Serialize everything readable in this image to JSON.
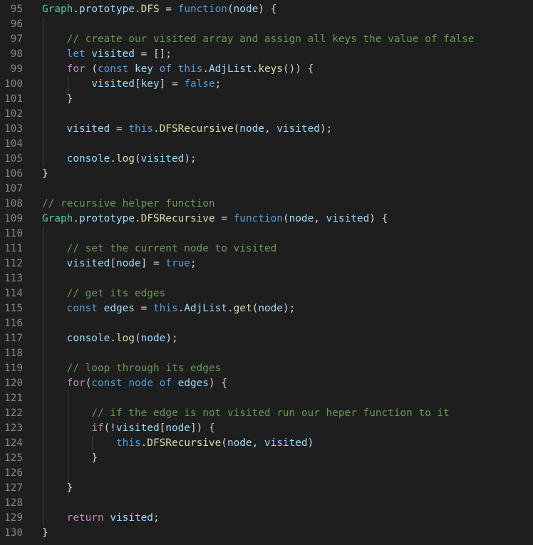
{
  "theme": {
    "background": "#1e1e1e",
    "line_number": "#858585",
    "guide": "#404040",
    "colors": {
      "plain": "#d4d4d4",
      "class": "#4ec9b0",
      "prop": "#9cdcfe",
      "func": "#dcdcaa",
      "kw": "#569cd6",
      "ctrl": "#c586c0",
      "var": "#9cdcfe",
      "param": "#9cdcfe",
      "cmt": "#6a9955",
      "op": "#d4d4d4",
      "punc": "#d4d4d4"
    }
  },
  "editor": {
    "lines": [
      {
        "num": "95",
        "tokens": [
          [
            "class",
            "Graph"
          ],
          [
            "punc",
            "."
          ],
          [
            "prop",
            "prototype"
          ],
          [
            "punc",
            "."
          ],
          [
            "func",
            "DFS"
          ],
          [
            "op",
            " = "
          ],
          [
            "kw",
            "function"
          ],
          [
            "punc",
            "("
          ],
          [
            "param",
            "node"
          ],
          [
            "punc",
            ") {"
          ]
        ]
      },
      {
        "num": "96",
        "tokens": []
      },
      {
        "num": "97",
        "tokens": [
          [
            "plain",
            "    "
          ],
          [
            "cmt",
            "// create our visited array and assign all keys the value of false"
          ]
        ]
      },
      {
        "num": "98",
        "tokens": [
          [
            "plain",
            "    "
          ],
          [
            "kw",
            "let"
          ],
          [
            "plain",
            " "
          ],
          [
            "var",
            "visited"
          ],
          [
            "op",
            " = "
          ],
          [
            "punc",
            "[];"
          ]
        ]
      },
      {
        "num": "99",
        "tokens": [
          [
            "plain",
            "    "
          ],
          [
            "ctrl",
            "for"
          ],
          [
            "punc",
            " ("
          ],
          [
            "kw",
            "const"
          ],
          [
            "plain",
            " "
          ],
          [
            "var",
            "key"
          ],
          [
            "plain",
            " "
          ],
          [
            "kw",
            "of"
          ],
          [
            "plain",
            " "
          ],
          [
            "kw",
            "this"
          ],
          [
            "punc",
            "."
          ],
          [
            "prop",
            "AdjList"
          ],
          [
            "punc",
            "."
          ],
          [
            "func",
            "keys"
          ],
          [
            "punc",
            "()) {"
          ]
        ]
      },
      {
        "num": "100",
        "tokens": [
          [
            "plain",
            "        "
          ],
          [
            "var",
            "visited"
          ],
          [
            "punc",
            "["
          ],
          [
            "var",
            "key"
          ],
          [
            "punc",
            "]"
          ],
          [
            "op",
            " = "
          ],
          [
            "kw",
            "false"
          ],
          [
            "punc",
            ";"
          ]
        ]
      },
      {
        "num": "101",
        "tokens": [
          [
            "plain",
            "    "
          ],
          [
            "punc",
            "}"
          ]
        ]
      },
      {
        "num": "102",
        "tokens": []
      },
      {
        "num": "103",
        "tokens": [
          [
            "plain",
            "    "
          ],
          [
            "var",
            "visited"
          ],
          [
            "op",
            " = "
          ],
          [
            "kw",
            "this"
          ],
          [
            "punc",
            "."
          ],
          [
            "func",
            "DFSRecursive"
          ],
          [
            "punc",
            "("
          ],
          [
            "var",
            "node"
          ],
          [
            "punc",
            ", "
          ],
          [
            "var",
            "visited"
          ],
          [
            "punc",
            ");"
          ]
        ]
      },
      {
        "num": "104",
        "tokens": []
      },
      {
        "num": "105",
        "tokens": [
          [
            "plain",
            "    "
          ],
          [
            "var",
            "console"
          ],
          [
            "punc",
            "."
          ],
          [
            "func",
            "log"
          ],
          [
            "punc",
            "("
          ],
          [
            "var",
            "visited"
          ],
          [
            "punc",
            ");"
          ]
        ]
      },
      {
        "num": "106",
        "tokens": [
          [
            "punc",
            "}"
          ]
        ]
      },
      {
        "num": "107",
        "tokens": []
      },
      {
        "num": "108",
        "tokens": [
          [
            "cmt",
            "// recursive helper function"
          ]
        ]
      },
      {
        "num": "109",
        "tokens": [
          [
            "class",
            "Graph"
          ],
          [
            "punc",
            "."
          ],
          [
            "prop",
            "prototype"
          ],
          [
            "punc",
            "."
          ],
          [
            "func",
            "DFSRecursive"
          ],
          [
            "op",
            " = "
          ],
          [
            "kw",
            "function"
          ],
          [
            "punc",
            "("
          ],
          [
            "param",
            "node"
          ],
          [
            "punc",
            ", "
          ],
          [
            "param",
            "visited"
          ],
          [
            "punc",
            ") {"
          ]
        ]
      },
      {
        "num": "110",
        "tokens": []
      },
      {
        "num": "111",
        "tokens": [
          [
            "plain",
            "    "
          ],
          [
            "cmt",
            "// set the current node to visited"
          ]
        ]
      },
      {
        "num": "112",
        "tokens": [
          [
            "plain",
            "    "
          ],
          [
            "var",
            "visited"
          ],
          [
            "punc",
            "["
          ],
          [
            "var",
            "node"
          ],
          [
            "punc",
            "]"
          ],
          [
            "op",
            " = "
          ],
          [
            "kw",
            "true"
          ],
          [
            "punc",
            ";"
          ]
        ]
      },
      {
        "num": "113",
        "tokens": []
      },
      {
        "num": "114",
        "tokens": [
          [
            "plain",
            "    "
          ],
          [
            "cmt",
            "// get its edges"
          ]
        ]
      },
      {
        "num": "115",
        "tokens": [
          [
            "plain",
            "    "
          ],
          [
            "kw",
            "const"
          ],
          [
            "plain",
            " "
          ],
          [
            "var",
            "edges"
          ],
          [
            "op",
            " = "
          ],
          [
            "kw",
            "this"
          ],
          [
            "punc",
            "."
          ],
          [
            "prop",
            "AdjList"
          ],
          [
            "punc",
            "."
          ],
          [
            "func",
            "get"
          ],
          [
            "punc",
            "("
          ],
          [
            "var",
            "node"
          ],
          [
            "punc",
            ");"
          ]
        ]
      },
      {
        "num": "116",
        "tokens": []
      },
      {
        "num": "117",
        "tokens": [
          [
            "plain",
            "    "
          ],
          [
            "var",
            "console"
          ],
          [
            "punc",
            "."
          ],
          [
            "func",
            "log"
          ],
          [
            "punc",
            "("
          ],
          [
            "var",
            "node"
          ],
          [
            "punc",
            ");"
          ]
        ]
      },
      {
        "num": "118",
        "tokens": []
      },
      {
        "num": "119",
        "tokens": [
          [
            "plain",
            "    "
          ],
          [
            "cmt",
            "// loop through its edges"
          ]
        ]
      },
      {
        "num": "120",
        "tokens": [
          [
            "plain",
            "    "
          ],
          [
            "ctrl",
            "for"
          ],
          [
            "punc",
            "("
          ],
          [
            "kw",
            "const"
          ],
          [
            "plain",
            " "
          ],
          [
            "kw",
            "node"
          ],
          [
            "plain",
            " "
          ],
          [
            "kw",
            "of"
          ],
          [
            "plain",
            " "
          ],
          [
            "var",
            "edges"
          ],
          [
            "punc",
            ") {"
          ]
        ]
      },
      {
        "num": "121",
        "tokens": []
      },
      {
        "num": "122",
        "tokens": [
          [
            "plain",
            "        "
          ],
          [
            "cmt",
            "// if the edge is not visited run our heper function to it"
          ]
        ]
      },
      {
        "num": "123",
        "tokens": [
          [
            "plain",
            "        "
          ],
          [
            "ctrl",
            "if"
          ],
          [
            "punc",
            "(!"
          ],
          [
            "var",
            "visited"
          ],
          [
            "punc",
            "["
          ],
          [
            "var",
            "node"
          ],
          [
            "punc",
            "]) {"
          ]
        ]
      },
      {
        "num": "124",
        "tokens": [
          [
            "plain",
            "            "
          ],
          [
            "kw",
            "this"
          ],
          [
            "punc",
            "."
          ],
          [
            "func",
            "DFSRecursive"
          ],
          [
            "punc",
            "("
          ],
          [
            "var",
            "node"
          ],
          [
            "punc",
            ", "
          ],
          [
            "var",
            "visited"
          ],
          [
            "punc",
            ")"
          ]
        ]
      },
      {
        "num": "125",
        "tokens": [
          [
            "plain",
            "        "
          ],
          [
            "punc",
            "}"
          ]
        ]
      },
      {
        "num": "126",
        "tokens": []
      },
      {
        "num": "127",
        "tokens": [
          [
            "plain",
            "    "
          ],
          [
            "punc",
            "}"
          ]
        ]
      },
      {
        "num": "128",
        "tokens": []
      },
      {
        "num": "129",
        "tokens": [
          [
            "plain",
            "    "
          ],
          [
            "ctrl",
            "return"
          ],
          [
            "plain",
            " "
          ],
          [
            "var",
            "visited"
          ],
          [
            "punc",
            ";"
          ]
        ]
      },
      {
        "num": "130",
        "tokens": [
          [
            "punc",
            "}"
          ]
        ]
      }
    ]
  }
}
